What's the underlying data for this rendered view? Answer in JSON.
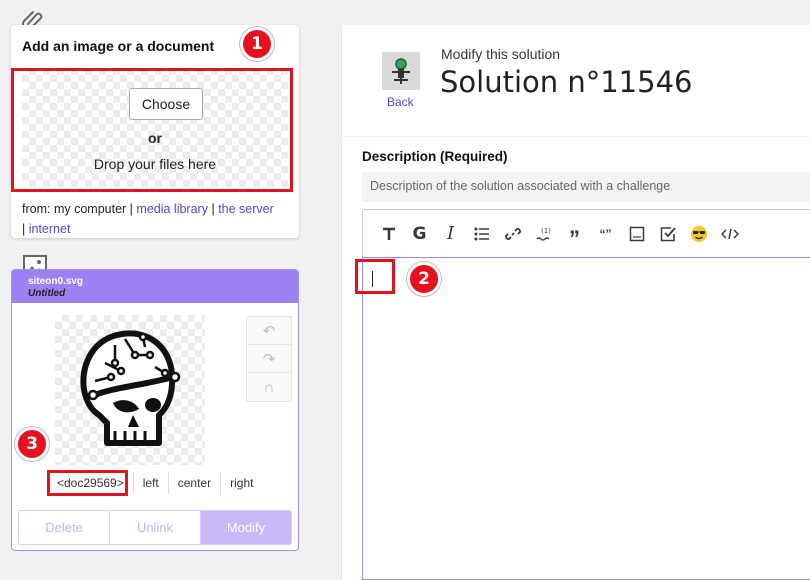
{
  "upload": {
    "title": "Add an image or a document",
    "choose_label": "Choose",
    "or_label": "or",
    "drop_label": "Drop your files here",
    "from_label": "from: my computer",
    "sep": "|",
    "links": [
      "media library",
      "the server",
      "internet"
    ]
  },
  "image_card": {
    "file_name": "siteon0.svg",
    "file_title": "Untitled",
    "doc_ref": "<doc29569>",
    "align_options": [
      "left",
      "center",
      "right"
    ],
    "actions": {
      "delete": "Delete",
      "unlink": "Unlink",
      "modify": "Modify"
    }
  },
  "header": {
    "back_label": "Back",
    "modify_label": "Modify this solution",
    "title": "Solution n°11546"
  },
  "editor": {
    "field_label": "Description (Required)",
    "hint": "Description of the solution associated with a challenge",
    "toolbar_icons": [
      "title-icon",
      "glossary-icon",
      "italic-icon",
      "bullet-list-icon",
      "link-icon",
      "footnote-icon",
      "quote-icon",
      "inline-quote-icon",
      "figure-icon",
      "checkbox-icon",
      "emoji-icon",
      "code-icon"
    ]
  },
  "annotations": [
    "1",
    "2",
    "3"
  ],
  "colors": {
    "accent": "#9b81f2",
    "link": "#5b46c9",
    "badge": "#e8101c"
  }
}
